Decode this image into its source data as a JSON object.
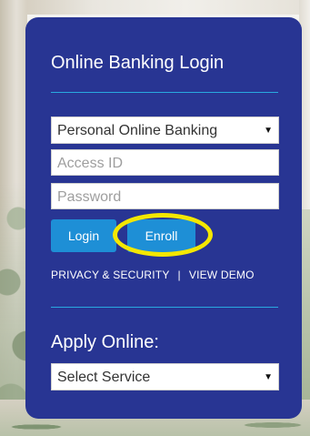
{
  "login": {
    "title": "Online Banking Login",
    "product_select": {
      "selected": "Personal Online Banking"
    },
    "access_id": {
      "placeholder": "Access ID"
    },
    "password": {
      "placeholder": "Password"
    },
    "login_button": "Login",
    "enroll_button": "Enroll",
    "links": {
      "privacy": "PRIVACY & SECURITY",
      "separator": "|",
      "demo": "VIEW DEMO"
    }
  },
  "apply": {
    "title": "Apply Online:",
    "service_select": {
      "selected": "Select Service"
    }
  },
  "icons": {
    "dropdown": "chevron-down-icon"
  },
  "colors": {
    "panel": "#283593",
    "accent": "#29a9df",
    "button": "#1e8fd6",
    "highlight": "#f4e700"
  }
}
